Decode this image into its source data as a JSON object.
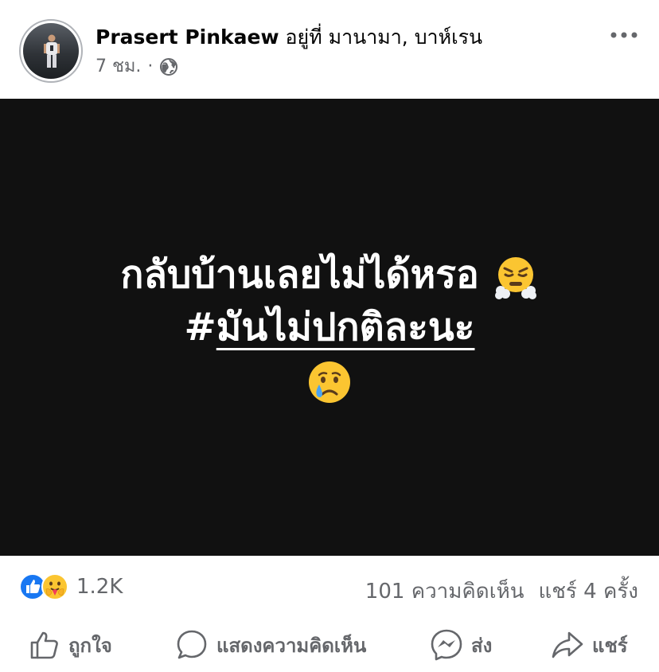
{
  "post": {
    "author_name": "Prasert Pinkaew",
    "location_text": "อยู่ที่ มานามา, บาห์เรน",
    "time_ago": "7 ชม.",
    "separator": "·",
    "audience_icon": "globe-icon",
    "more_icon": "more-dots-icon",
    "content": {
      "line1": "กลับบ้านเลยไม่ได้หรอ",
      "line1_emoji": "face-with-steam-from-nose",
      "hash_symbol": "#",
      "hashtag": "มันไม่ปกติละนะ",
      "line3_emoji": "crying-face"
    }
  },
  "stats": {
    "reaction_icons": [
      "like-icon",
      "care-icon"
    ],
    "reaction_count": "1.2K",
    "comments": "101 ความคิดเห็น",
    "shares": "แชร์ 4 ครั้ง"
  },
  "actions": {
    "like": "ถูกใจ",
    "comment": "แสดงความคิดเห็น",
    "send": "ส่ง",
    "share": "แชร์"
  },
  "colors": {
    "media_background": "#111111",
    "secondary_text": "#65676b",
    "like_blue": "#1877f2"
  }
}
